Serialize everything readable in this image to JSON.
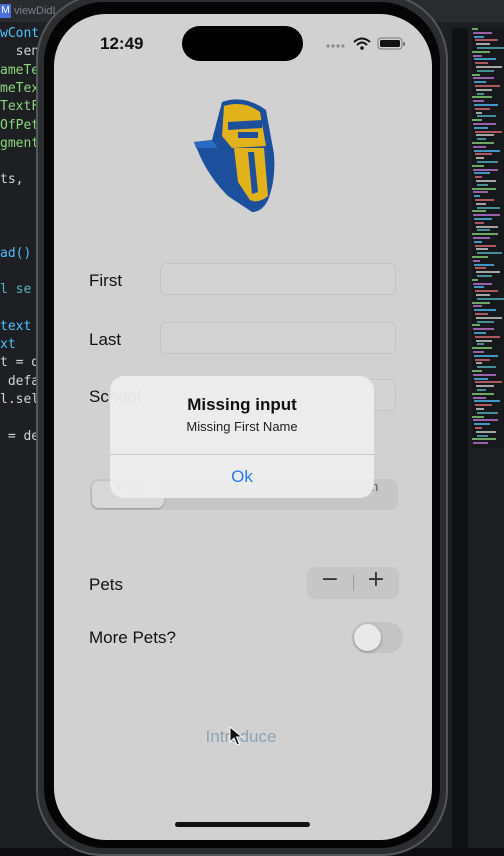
{
  "editor": {
    "badge": "M",
    "tab_label": "viewDidL",
    "code_lines": [
      {
        "text": "wCont",
        "color": "#4fc1ff"
      },
      {
        "text": "  sen",
        "color": "#d4d4d4"
      },
      {
        "text": "ameTe",
        "color": "#8bd77e"
      },
      {
        "text": "meTex",
        "color": "#8bd77e"
      },
      {
        "text": "TextF",
        "color": "#8bd77e"
      },
      {
        "text": "OfPet",
        "color": "#8bd77e"
      },
      {
        "text": "gment",
        "color": "#8bd77e"
      },
      {
        "text": "",
        "color": "#d4d4d4"
      },
      {
        "text": "ts,",
        "color": "#d4d4d4"
      },
      {
        "text": "",
        "color": "#d4d4d4"
      },
      {
        "text": "",
        "color": "#d4d4d4"
      },
      {
        "text": "",
        "color": "#d4d4d4"
      },
      {
        "text": "ad()",
        "color": "#4fc1ff"
      },
      {
        "text": "",
        "color": "#d4d4d4"
      },
      {
        "text": "l se",
        "color": "#56b6c2"
      },
      {
        "text": "",
        "color": "#d4d4d4"
      },
      {
        "text": "text",
        "color": "#4fc1ff"
      },
      {
        "text": "xt",
        "color": "#4fc1ff"
      },
      {
        "text": "t = d",
        "color": "#d4d4d4"
      },
      {
        "text": " defa",
        "color": "#d4d4d4"
      },
      {
        "text": "l.sel",
        "color": "#d4d4d4"
      },
      {
        "text": "",
        "color": "#d4d4d4"
      },
      {
        "text": " = de",
        "color": "#d4d4d4"
      }
    ]
  },
  "status_bar": {
    "time": "12:49"
  },
  "form": {
    "first_label": "First",
    "last_label": "Last",
    "school_label": "School",
    "first_value": "",
    "last_value": "",
    "school_value": ""
  },
  "segments": {
    "items": [
      "First",
      "Second",
      "Third",
      "Fourth"
    ],
    "selected_index": 0
  },
  "pets": {
    "label": "Pets",
    "minus": "−",
    "plus": "+"
  },
  "more_pets": {
    "label": "More Pets?",
    "on": false
  },
  "introduce_button": "Introduce",
  "alert": {
    "title": "Missing input",
    "message": "Missing First Name",
    "ok_label": "Ok"
  },
  "colors": {
    "accent": "#2b7de9",
    "logo_blue": "#1c4f9c",
    "logo_gold": "#e2b21d"
  }
}
